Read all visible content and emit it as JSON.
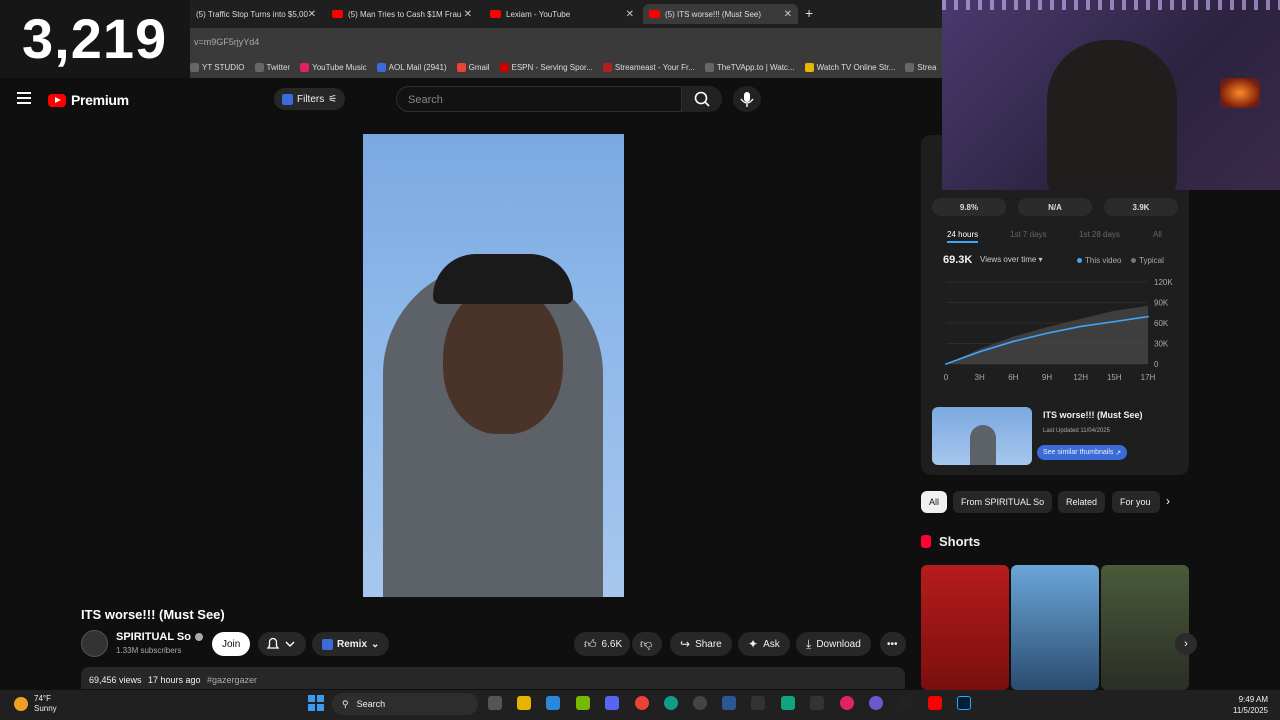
{
  "browser": {
    "tabs": [
      {
        "label": "(5) Traffic Stop Turns into $5,00"
      },
      {
        "label": "(5) Man Tries to Cash $1M Frau"
      },
      {
        "label": "Lexiam - YouTube"
      },
      {
        "label": "(5) ITS worse!!! (Must See)"
      }
    ],
    "new_tab": "+",
    "url": "v=m9GF5rjyYd4",
    "bookmarks": [
      "YT STUDIO",
      "Twitter",
      "YouTube Music",
      "AOL Mail (2941)",
      "Gmail",
      "ESPN - Serving Spor...",
      "Streameast - Your Fr...",
      "TheTVApp.to | Watc...",
      "Watch TV Online Str...",
      "Strea"
    ]
  },
  "overlay": {
    "counter": "3,219"
  },
  "header": {
    "brand": "Premium",
    "filters_label": "Filters",
    "search_placeholder": "Search"
  },
  "video": {
    "title": "ITS worse!!! (Must See)",
    "channel": "SPIRITUAL So",
    "subscribers": "1.33M subscribers",
    "join_label": "Join",
    "remix_label": "Remix",
    "likes": "6.6K",
    "share_label": "Share",
    "ask_label": "Ask",
    "download_label": "Download",
    "views": "69,456 views",
    "age": "17 hours ago",
    "hashtag": "#gazergazer"
  },
  "stats": {
    "boxes": [
      "9.8%",
      "N/A",
      "3.9K"
    ],
    "periods": [
      "24 hours",
      "1st 7 days",
      "1st 28 days",
      "All"
    ],
    "total": "69.3K",
    "metric_select": "Views over time",
    "legend_this": "This video",
    "legend_typical": "Typical",
    "thumb_title": "ITS worse!!! (Must See)",
    "thumb_updated": "Last Updated 11/04/2025",
    "similar_label": "See similar thumbnails"
  },
  "chart_data": {
    "type": "line",
    "x": [
      "0",
      "3H",
      "6H",
      "9H",
      "12H",
      "15H",
      "17H"
    ],
    "ylabels": [
      "120K",
      "90K",
      "60K",
      "30K",
      "0"
    ],
    "ylim": [
      0,
      120000
    ],
    "series": [
      {
        "name": "This video",
        "values": [
          0,
          18000,
          33000,
          45000,
          55000,
          62000,
          69300
        ]
      },
      {
        "name": "Typical",
        "values": [
          0,
          22000,
          40000,
          54000,
          66000,
          78000,
          85000
        ]
      }
    ]
  },
  "chips": [
    "All",
    "From SPIRITUAL So",
    "Related",
    "For you"
  ],
  "shorts": {
    "heading": "Shorts"
  },
  "taskbar": {
    "temp": "74°F",
    "condition": "Sunny",
    "search": "Search",
    "time": "9:49 AM",
    "date": "11/5/2025"
  },
  "colors": {
    "accent": "#3ea6ff",
    "brand": "#ff0000",
    "chip_blue": "#3b6bd8"
  }
}
